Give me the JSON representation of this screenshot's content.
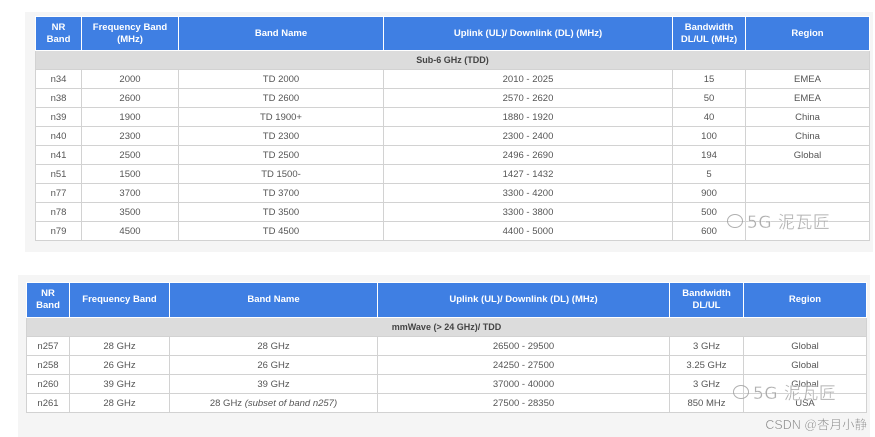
{
  "table1": {
    "headers": [
      "NR Band",
      "Frequency Band (MHz)",
      "Band Name",
      "Uplink (UL)/ Downlink (DL) (MHz)",
      "Bandwidth DL/UL (MHz)",
      "Region"
    ],
    "group_label": "Sub-6 GHz (TDD)",
    "rows": [
      [
        "n34",
        "2000",
        "TD 2000",
        "2010 - 2025",
        "15",
        "EMEA"
      ],
      [
        "n38",
        "2600",
        "TD 2600",
        "2570 - 2620",
        "50",
        "EMEA"
      ],
      [
        "n39",
        "1900",
        "TD 1900+",
        "1880 - 1920",
        "40",
        "China"
      ],
      [
        "n40",
        "2300",
        "TD 2300",
        "2300 - 2400",
        "100",
        "China"
      ],
      [
        "n41",
        "2500",
        "TD 2500",
        "2496 - 2690",
        "194",
        "Global"
      ],
      [
        "n51",
        "1500",
        "TD 1500-",
        "1427 - 1432",
        "5",
        ""
      ],
      [
        "n77",
        "3700",
        "TD 3700",
        "3300 - 4200",
        "900",
        ""
      ],
      [
        "n78",
        "3500",
        "TD 3500",
        "3300 - 3800",
        "500",
        ""
      ],
      [
        "n79",
        "4500",
        "TD 4500",
        "4400 - 5000",
        "600",
        ""
      ]
    ]
  },
  "table2": {
    "headers": [
      "NR Band",
      "Frequency Band",
      "Band Name",
      "Uplink (UL)/ Downlink (DL) (MHz)",
      "Bandwidth DL/UL",
      "Region"
    ],
    "group_label": "mmWave (> 24 GHz)/ TDD",
    "rows": [
      [
        "n257",
        "28 GHz",
        "28 GHz",
        "26500 - 29500",
        "3 GHz",
        "Global"
      ],
      [
        "n258",
        "26 GHz",
        "26 GHz",
        "24250 - 27500",
        "3.25 GHz",
        "Global"
      ],
      [
        "n260",
        "39 GHz",
        "39 GHz",
        "37000 - 40000",
        "3 GHz",
        "Global"
      ],
      [
        "n261",
        "28 GHz",
        "28 GHz",
        "27500 - 28350",
        "850 MHz",
        "USA"
      ]
    ],
    "n261_band_name_note": "(subset of band n257)"
  },
  "watermarks": {
    "brand1": "5G 泥瓦匠",
    "brand2": "5G 泥瓦匠",
    "csdn": "CSDN @杏月小静"
  }
}
